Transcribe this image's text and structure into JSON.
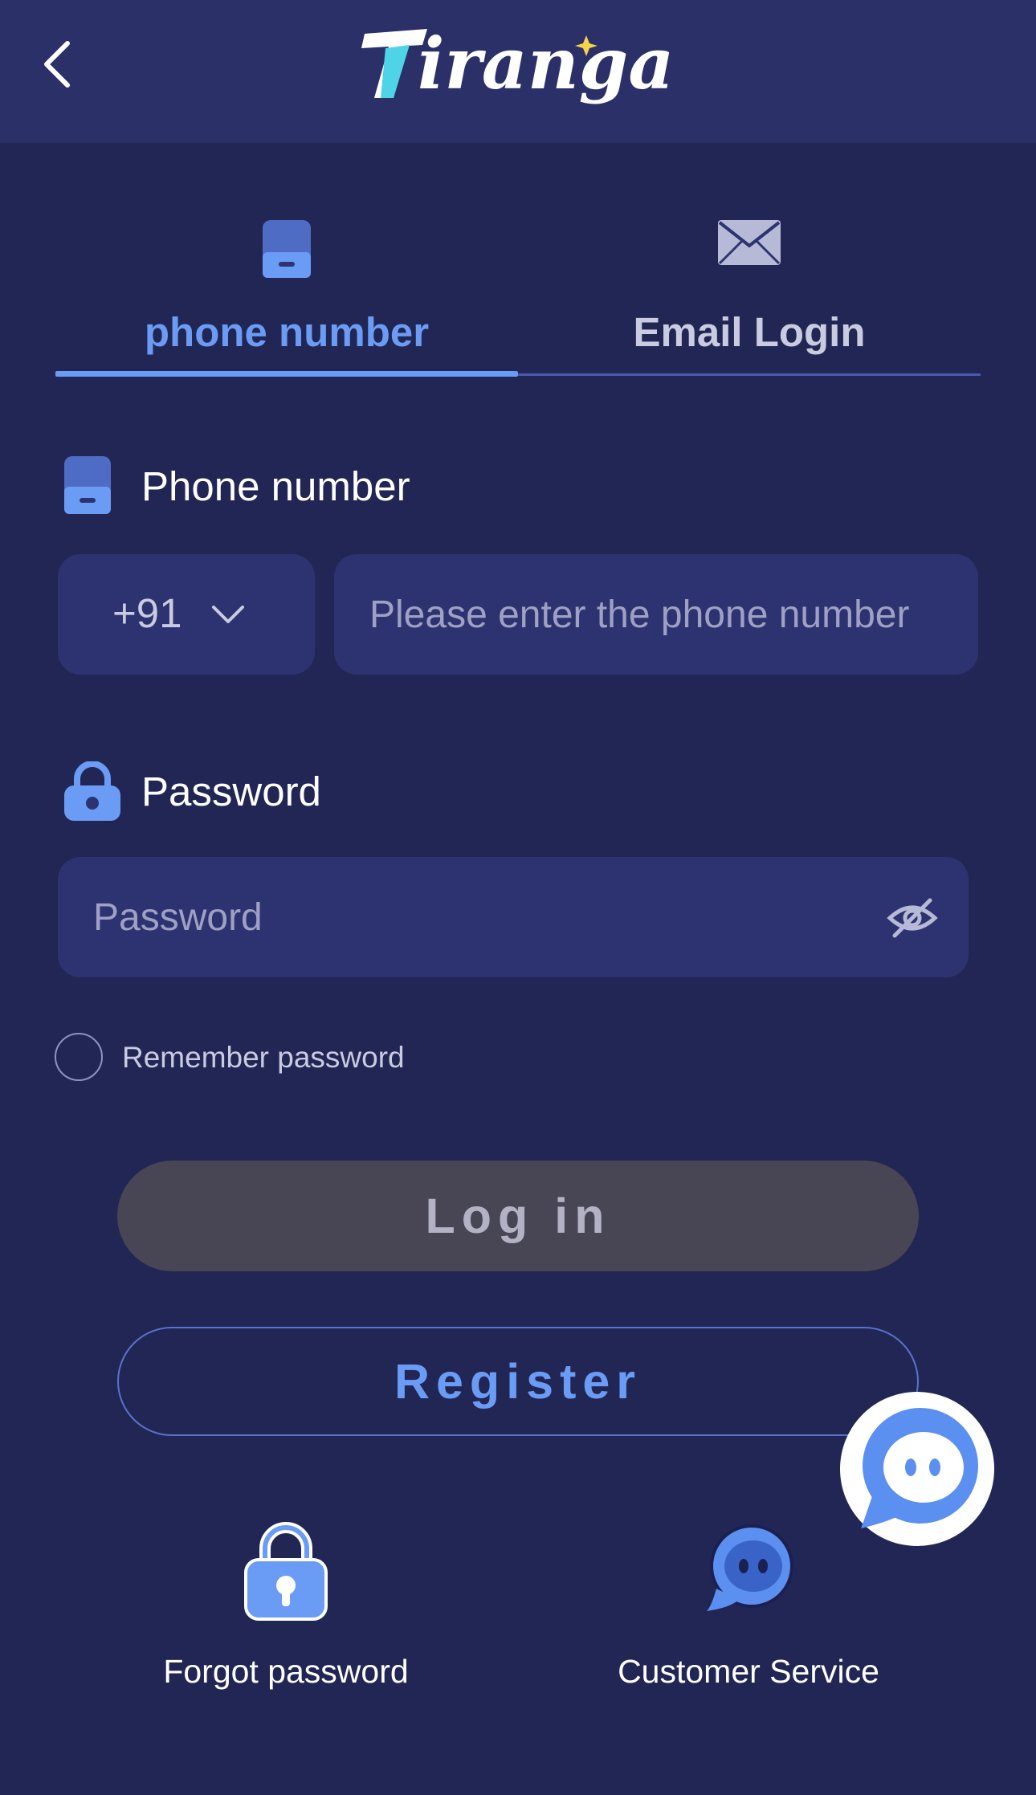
{
  "header": {
    "back_icon": "chevron-left-icon",
    "logo_text": "Tiranga"
  },
  "tabs": [
    {
      "label": "phone number",
      "icon": "phone-icon",
      "active": true
    },
    {
      "label": "Email Login",
      "icon": "envelope-icon",
      "active": false
    }
  ],
  "phone_field": {
    "label": "Phone number",
    "icon": "phone-icon",
    "country_code": "+91",
    "placeholder": "Please enter the phone number"
  },
  "password_field": {
    "label": "Password",
    "icon": "lock-icon",
    "placeholder": "Password",
    "toggle_icon": "eye-off-icon"
  },
  "remember": {
    "label": "Remember password",
    "checked": false
  },
  "buttons": {
    "login": "Log in",
    "register": "Register"
  },
  "bottom": {
    "forgot": {
      "label": "Forgot password",
      "icon": "lock-icon"
    },
    "service": {
      "label": "Customer Service",
      "icon": "chat-bot-icon"
    }
  },
  "colors": {
    "background": "#222654",
    "header": "#2b3068",
    "input": "#2d3370",
    "accent": "#6a9cf5",
    "login_disabled": "#484655"
  }
}
